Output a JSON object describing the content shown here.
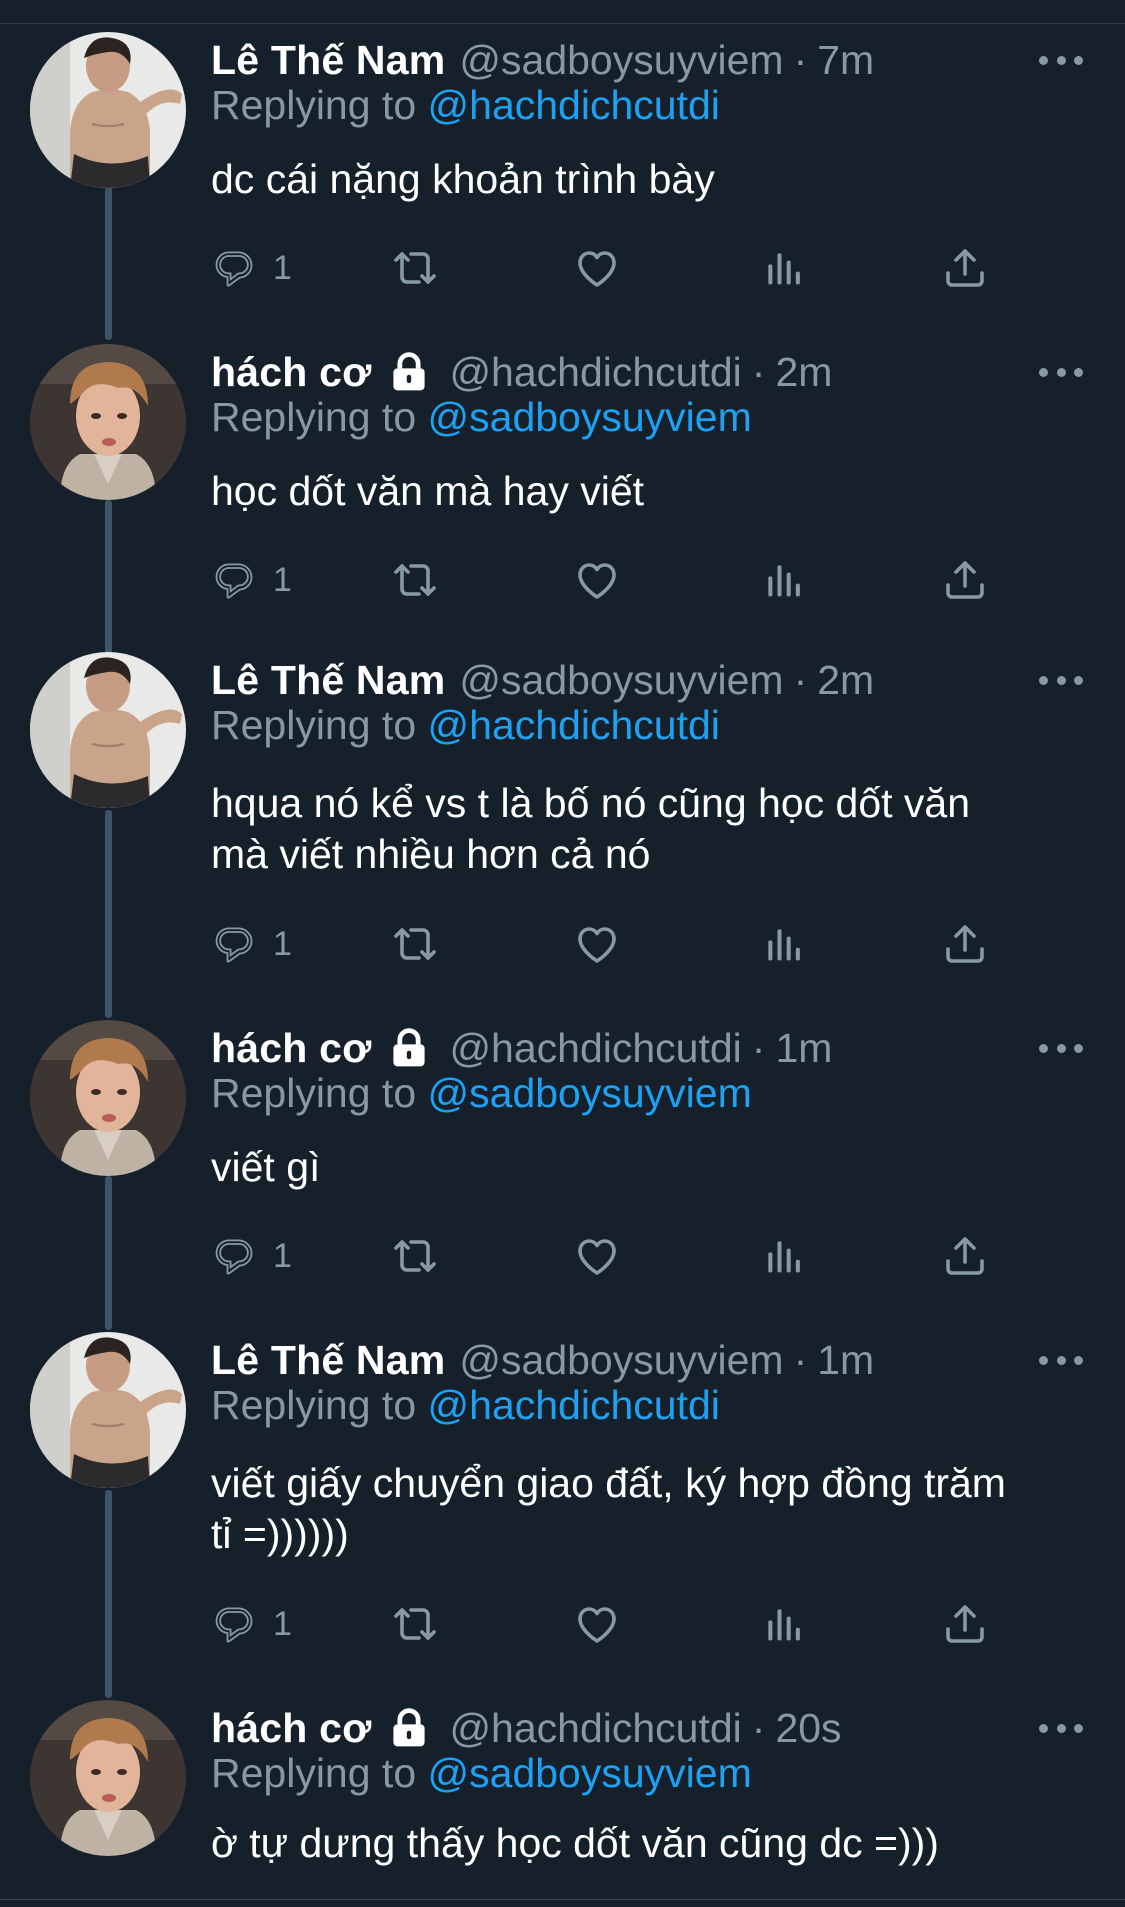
{
  "colors": {
    "background": "#15202b",
    "primary_text": "#ffffff",
    "secondary_text": "#8899a6",
    "link": "#1da1f2",
    "thread_line": "#3d5466"
  },
  "replying_prefix": "Replying to",
  "icons": [
    "reply-icon",
    "retweet-icon",
    "like-icon",
    "analytics-icon",
    "share-icon",
    "more-icon",
    "lock-icon"
  ],
  "tweets": [
    {
      "name": "Lê Thế Nam",
      "handle": "@sadboysuyviem",
      "separator": "·",
      "time": "7m",
      "replying_to": "@hachdichcutdi",
      "text": "dc cái nặng khoản trình bày",
      "reply_count": "1",
      "protected": false
    },
    {
      "name": "hách cơ",
      "handle": "@hachdichcutdi",
      "separator": "·",
      "time": "2m",
      "replying_to": "@sadboysuyviem",
      "text": "học dốt văn mà hay viết",
      "reply_count": "1",
      "protected": true
    },
    {
      "name": "Lê Thế Nam",
      "handle": "@sadboysuyviem",
      "separator": "·",
      "time": "2m",
      "replying_to": "@hachdichcutdi",
      "text_lines": [
        "hqua nó kể vs t là bố nó cũng học dốt văn",
        "mà viết nhiều hơn cả nó"
      ],
      "reply_count": "1",
      "protected": false
    },
    {
      "name": "hách cơ",
      "handle": "@hachdichcutdi",
      "separator": "·",
      "time": "1m",
      "replying_to": "@sadboysuyviem",
      "text": "viết gì",
      "reply_count": "1",
      "protected": true
    },
    {
      "name": "Lê Thế Nam",
      "handle": "@sadboysuyviem",
      "separator": "·",
      "time": "1m",
      "replying_to": "@hachdichcutdi",
      "text_lines": [
        "viết giấy chuyển giao đất, ký hợp đồng trăm",
        "tỉ =))))))"
      ],
      "reply_count": "1",
      "protected": false
    },
    {
      "name": "hách cơ",
      "handle": "@hachdichcutdi",
      "separator": "·",
      "time": "20s",
      "replying_to": "@sadboysuyviem",
      "text": "ờ tự dưng thấy học dốt văn cũng dc =)))",
      "protected": true
    }
  ]
}
